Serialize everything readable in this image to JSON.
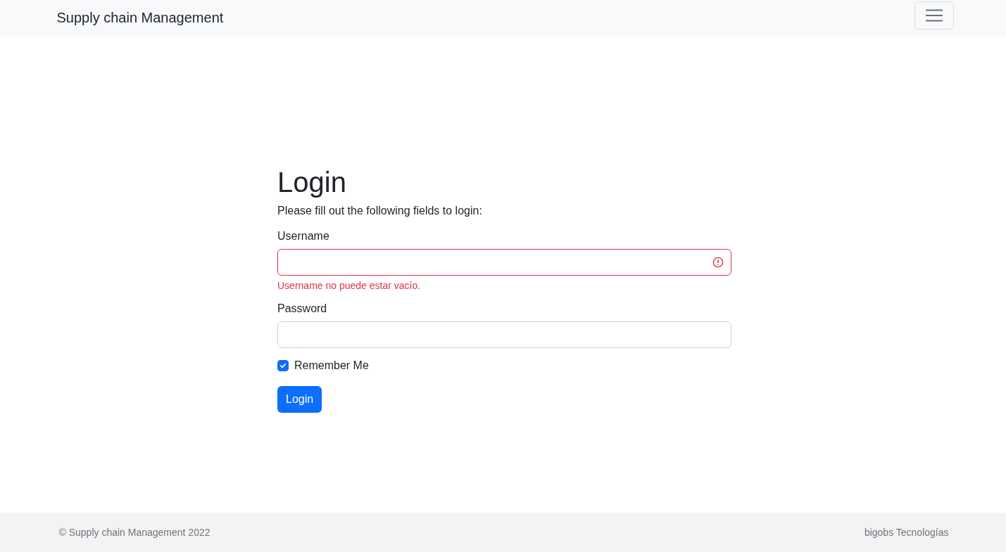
{
  "navbar": {
    "brand": "Supply chain Management"
  },
  "form": {
    "title": "Login",
    "intro": "Please fill out the following fields to login:",
    "fields": [
      {
        "label": "Username",
        "invalid": true,
        "error": "Username no puede estar vacío."
      },
      {
        "label": "Password",
        "invalid": false
      }
    ],
    "remember": {
      "label": "Remember Me",
      "checked": true
    },
    "submit": "Login"
  },
  "footer": {
    "left": "© Supply chain Management 2022",
    "right": "bigobs Tecnologías"
  }
}
